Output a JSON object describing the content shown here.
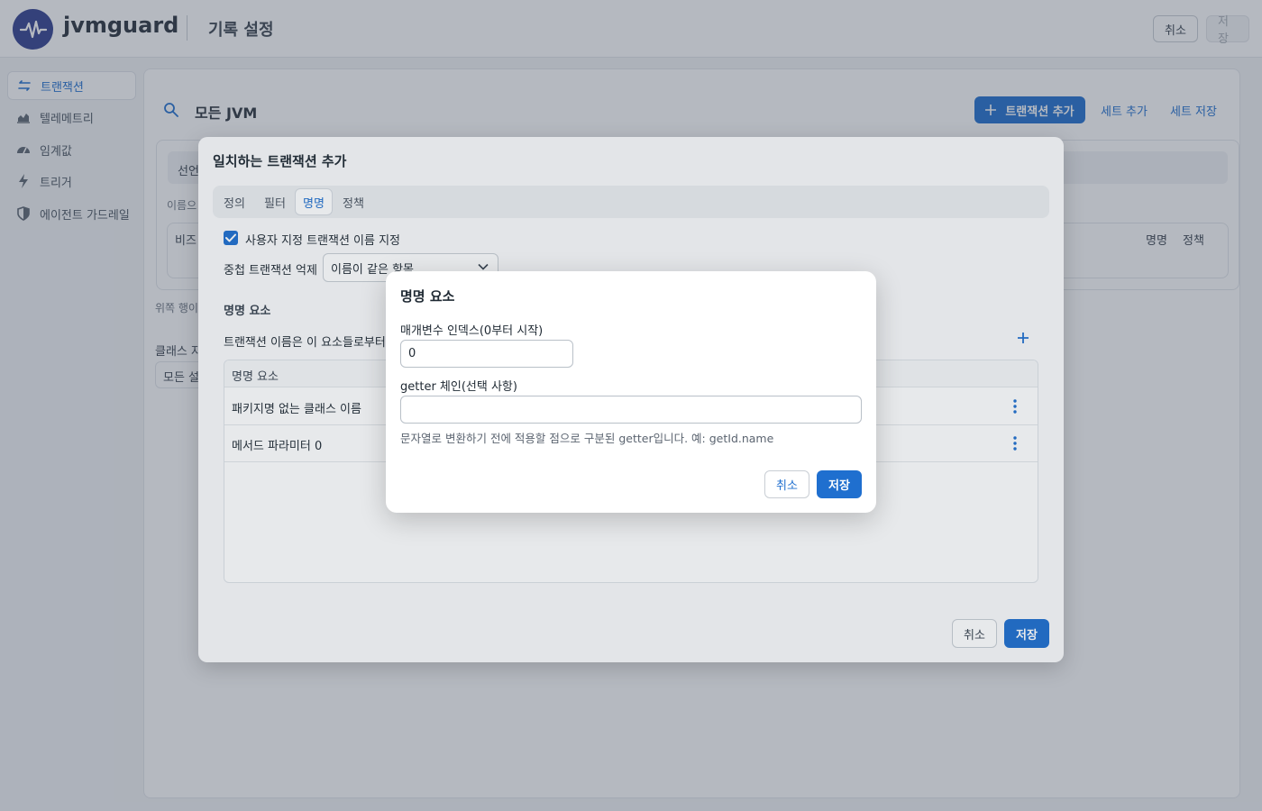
{
  "header": {
    "app_name": "jvmguard",
    "page_title": "기록 설정",
    "cancel_label": "취소",
    "save_label": "저장"
  },
  "sidebar": {
    "items": [
      {
        "label": "트랜잭션",
        "icon": "transactions-icon",
        "active": true
      },
      {
        "label": "텔레메트리",
        "icon": "telemetry-chart-icon",
        "active": false
      },
      {
        "label": "임계값",
        "icon": "gauge-icon",
        "active": false
      },
      {
        "label": "트리거",
        "icon": "lightning-icon",
        "active": false
      },
      {
        "label": "에이전트 가드레일",
        "icon": "shield-icon",
        "active": false
      }
    ]
  },
  "main": {
    "title": "모든 JVM",
    "add_transaction_label": "트랜잭션 추가",
    "add_set_label": "세트 추가",
    "save_set_label": "세트 저장",
    "bg_tab_fragment": "선언",
    "bg_hint_fragment": "이름으",
    "bg_col_fragment": "비즈",
    "bg_col_naming": "명명",
    "bg_col_policy": "정책",
    "bg_note_fragment": "위쪽 행이 ",
    "bg_class_fragment": "클래스 자",
    "bg_select_fragment": "모든 설"
  },
  "dialog": {
    "title": "일치하는 트랜잭션 추가",
    "tabs": [
      "정의",
      "필터",
      "명명",
      "정책"
    ],
    "active_tab": "명명",
    "custom_name_checkbox_label": "사용자 지정 트랜잭션 이름 지정",
    "custom_name_checked": true,
    "dup_suppress_label": "중첩 트랜잭션 억제",
    "dup_suppress_value": "이름이 같은 항목",
    "naming_section_label": "명명 요소",
    "naming_desc": "트랜잭션 이름은 이 요소들로부터",
    "table_header": "명명 요소",
    "rows": [
      "패키지명 없는 클래스 이름",
      "메서드 파라미터 0"
    ],
    "cancel_label": "취소",
    "save_label": "저장"
  },
  "modal": {
    "title": "명명 요소",
    "param_index_label": "매개변수 인덱스(0부터 시작)",
    "param_index_value": "0",
    "getter_label": "getter 체인(선택 사항)",
    "getter_value": "",
    "getter_help": "문자열로 변환하기 전에 적용할 점으로 구분된 getter입니다. 예: getId.name",
    "cancel_label": "취소",
    "save_label": "저장"
  },
  "colors": {
    "accent": "#1f6fcf",
    "brand": "#2f3e8e"
  }
}
